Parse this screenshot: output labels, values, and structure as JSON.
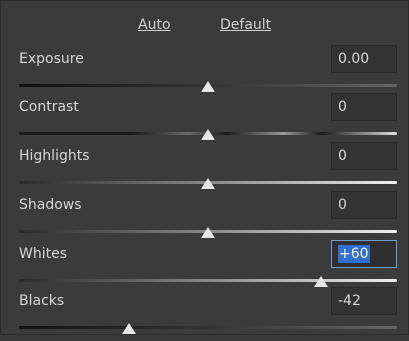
{
  "links": {
    "auto": "Auto",
    "default": "Default"
  },
  "sliders": [
    {
      "label": "Exposure",
      "value": "0.00",
      "position": 0.5
    },
    {
      "label": "Contrast",
      "value": "0",
      "position": 0.5
    },
    {
      "label": "Highlights",
      "value": "0",
      "position": 0.5
    },
    {
      "label": "Shadows",
      "value": "0",
      "position": 0.5
    },
    {
      "label": "Whites",
      "value": "+60",
      "position": 0.8
    },
    {
      "label": "Blacks",
      "value": "-42",
      "position": 0.29
    }
  ]
}
